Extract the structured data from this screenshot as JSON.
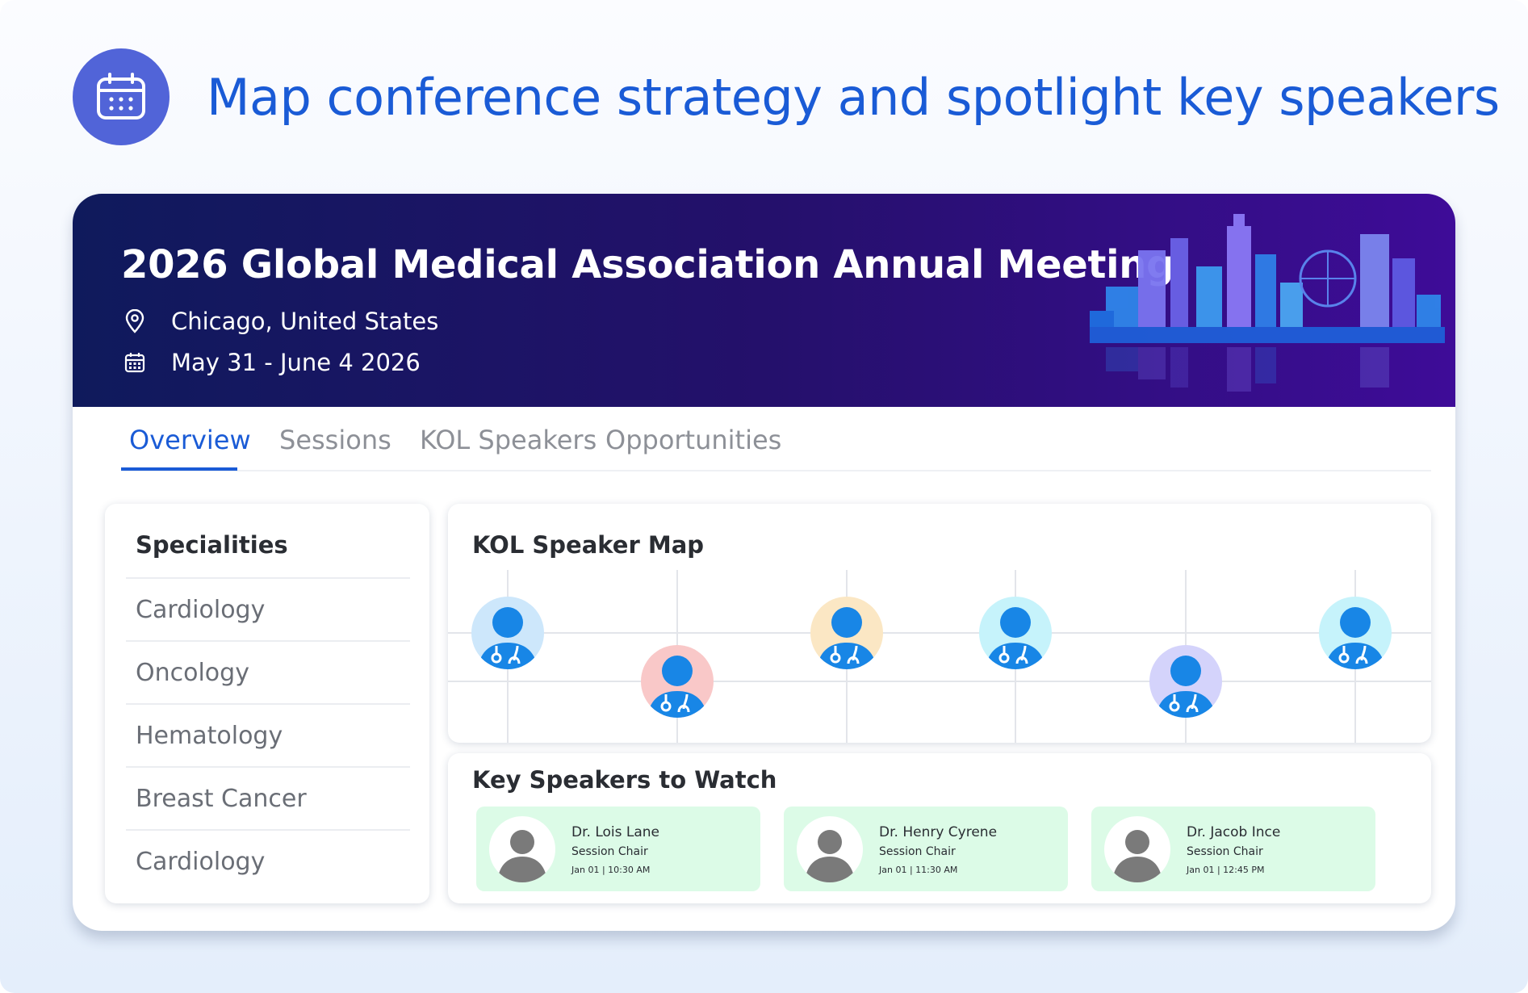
{
  "header": {
    "title": "Map conference strategy and spotlight key speakers",
    "icon": "calendar-icon",
    "accent_color": "#1a5bd6"
  },
  "event": {
    "title": "2026 Global Medical Association Annual Meeting",
    "location": "Chicago, United States",
    "dates": "May 31 - June 4 2026"
  },
  "tabs": [
    {
      "label": "Overview",
      "active": true
    },
    {
      "label": "Sessions",
      "active": false
    },
    {
      "label": "KOL Speakers",
      "active": false
    },
    {
      "label": "Opportunities",
      "active": false
    }
  ],
  "specialities": {
    "heading": "Specialities",
    "items": [
      "Cardiology",
      "Oncology",
      "Hematology",
      "Breast Cancer",
      "Cardiology"
    ]
  },
  "kol_map": {
    "title": "KOL Speaker Map",
    "speakers": [
      {
        "icon": "doctor-icon",
        "color": "#cde7fb"
      },
      {
        "icon": "doctor-icon",
        "color": "#f9c8c8"
      },
      {
        "icon": "doctor-icon",
        "color": "#fbe7c4"
      },
      {
        "icon": "doctor-icon",
        "color": "#c6f3fb"
      },
      {
        "icon": "doctor-icon",
        "color": "#d4d3fb"
      },
      {
        "icon": "doctor-icon",
        "color": "#c6f3fb"
      }
    ]
  },
  "key_speakers": {
    "title": "Key Speakers to Watch",
    "items": [
      {
        "name": "Dr. Lois Lane",
        "role": "Session Chair",
        "time": "Jan 01  |  10:30 AM"
      },
      {
        "name": "Dr. Henry Cyrene",
        "role": "Session Chair",
        "time": "Jan 01  |  11:30 AM"
      },
      {
        "name": "Dr. Jacob Ince",
        "role": "Session Chair",
        "time": "Jan 01  |  12:45 PM"
      }
    ]
  }
}
